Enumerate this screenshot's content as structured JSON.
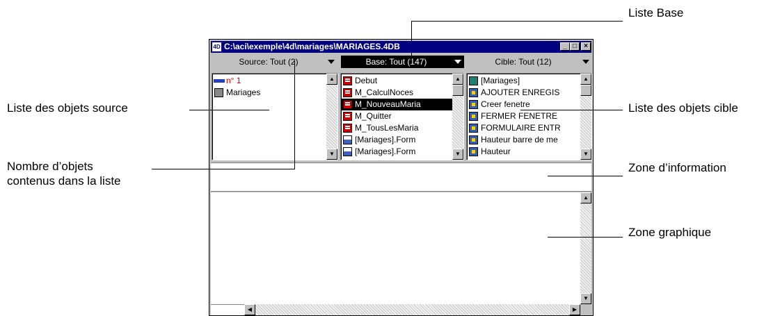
{
  "window": {
    "title": "C:\\aci\\exemple\\4d\\mariages\\MARIAGES.4DB",
    "app_icon": "4D",
    "minimize": "_",
    "maximize": "□",
    "close": "×"
  },
  "source": {
    "header": "Source: Tout (2)",
    "items": [
      {
        "label": "n° 1",
        "icon": "ruler-icon"
      },
      {
        "label": "Mariages",
        "icon": "base-icon"
      }
    ]
  },
  "base": {
    "header": "Base: Tout (147)",
    "items": [
      {
        "label": "Debut",
        "icon": "method-icon"
      },
      {
        "label": "M_CalculNoces",
        "icon": "method-icon"
      },
      {
        "label": "M_NouveauMaria",
        "icon": "method-icon",
        "selected": true
      },
      {
        "label": "M_Quitter",
        "icon": "method-icon"
      },
      {
        "label": "M_TousLesMaria",
        "icon": "method-icon"
      },
      {
        "label": "[Mariages].Form",
        "icon": "form-icon"
      },
      {
        "label": "[Mariages].Form",
        "icon": "form-icon"
      }
    ]
  },
  "cible": {
    "header": "Cible: Tout (12)",
    "items": [
      {
        "label": "[Mariages]",
        "icon": "table-icon"
      },
      {
        "label": "AJOUTER ENREGIS",
        "icon": "command-icon"
      },
      {
        "label": "Creer fenetre",
        "icon": "command-icon"
      },
      {
        "label": "FERMER FENETRE",
        "icon": "command-icon"
      },
      {
        "label": "FORMULAIRE ENTR",
        "icon": "command-icon"
      },
      {
        "label": "Hauteur barre de me",
        "icon": "command-icon"
      },
      {
        "label": "Hauteur",
        "icon": "command-icon"
      }
    ]
  },
  "callouts": {
    "liste_base": "Liste Base",
    "source_list": "Liste des objets source",
    "count_line1": "Nombre d’objets",
    "count_line2": "contenus dans la liste",
    "target_list": "Liste des objets cible",
    "info_zone": "Zone d’information",
    "graph_zone": "Zone graphique"
  },
  "colors": {
    "titlebar": "#000080",
    "selection": "#000000",
    "source_first_item": "#d00000"
  }
}
